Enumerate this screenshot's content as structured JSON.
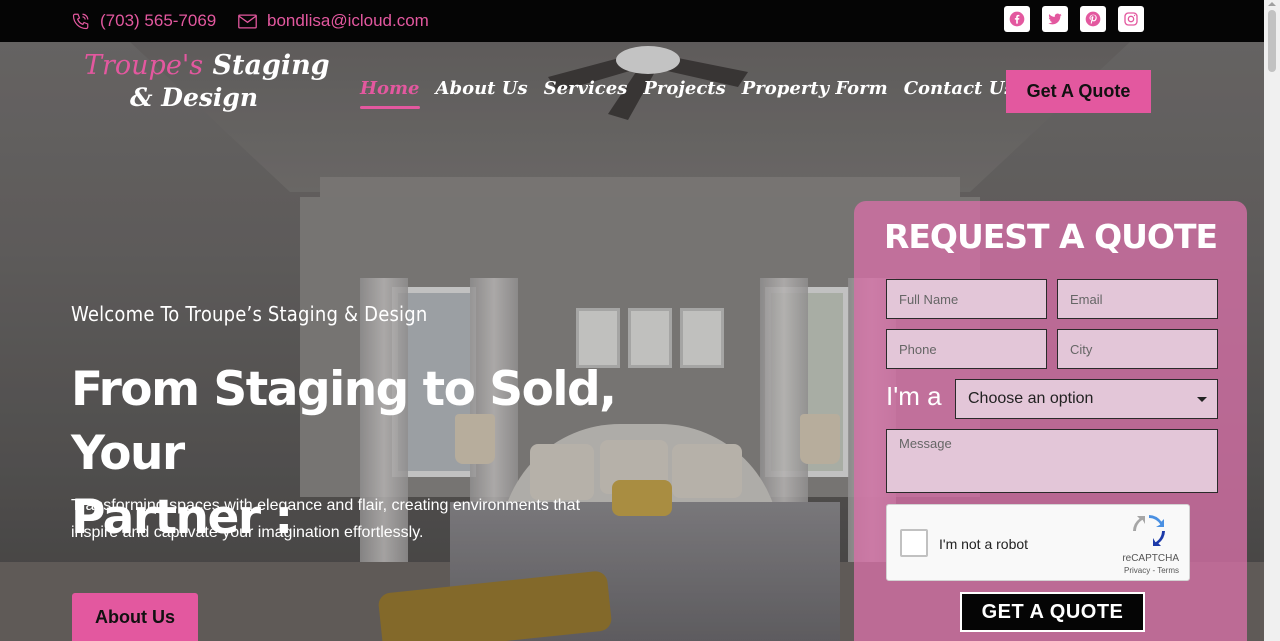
{
  "topbar": {
    "phone": "(703) 565-7069",
    "email": "bondlisa@icloud.com",
    "socials": [
      {
        "icon": "facebook-icon",
        "color": "#e3589f"
      },
      {
        "icon": "twitter-icon",
        "color": "#e3589f"
      },
      {
        "icon": "pinterest-icon",
        "color": "#e3589f"
      },
      {
        "icon": "instagram-icon",
        "color": "#e3589f"
      }
    ]
  },
  "logo": {
    "line1_pink": "Troupe's",
    "line1_white": "Staging",
    "line2": "& Design"
  },
  "nav": {
    "items": [
      {
        "label": "Home",
        "active": true
      },
      {
        "label": "About Us"
      },
      {
        "label": "Services"
      },
      {
        "label": "Projects"
      },
      {
        "label": "Property Form"
      },
      {
        "label": "Contact Us"
      }
    ],
    "cta": "Get A Quote"
  },
  "hero": {
    "welcome": "Welcome To Troupe’s Staging & Design",
    "headline_line1": "From Staging to Sold, Your",
    "headline_line2": "Partner :",
    "subtext": "Transforming spaces with elegance and flair, creating environments that inspire and captivate your imagination effortlessly.",
    "cta": "About Us"
  },
  "quote_form": {
    "title": "REQUEST A QUOTE",
    "full_name_placeholder": "Full Name",
    "email_placeholder": "Email",
    "phone_placeholder": "Phone",
    "city_placeholder": "City",
    "im_a_label": "I'm a",
    "im_a_selected": "Choose an option",
    "message_placeholder": "Message",
    "captcha_label": "I'm not a robot",
    "captcha_brand": "reCAPTCHA",
    "captcha_terms": "Privacy - Terms",
    "submit": "GET A QUOTE"
  },
  "colors": {
    "accent": "#e3589f",
    "topbar_bg": "#050505",
    "form_bg": "#d670a6"
  }
}
